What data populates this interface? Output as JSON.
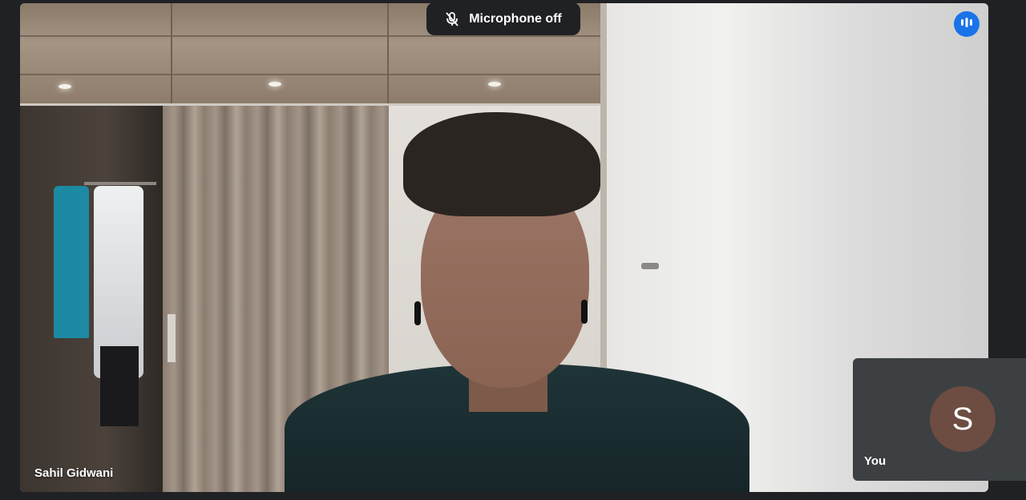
{
  "banner": {
    "mic_status_label": "Microphone off",
    "icon": "mic-off-icon"
  },
  "speaking_indicator": {
    "icon": "audio-level-icon",
    "color": "#1a73e8"
  },
  "main_participant": {
    "name": "Sahil Gidwani"
  },
  "self_view": {
    "avatar_initial": "S",
    "avatar_color": "#6d4c41",
    "label": "You"
  }
}
